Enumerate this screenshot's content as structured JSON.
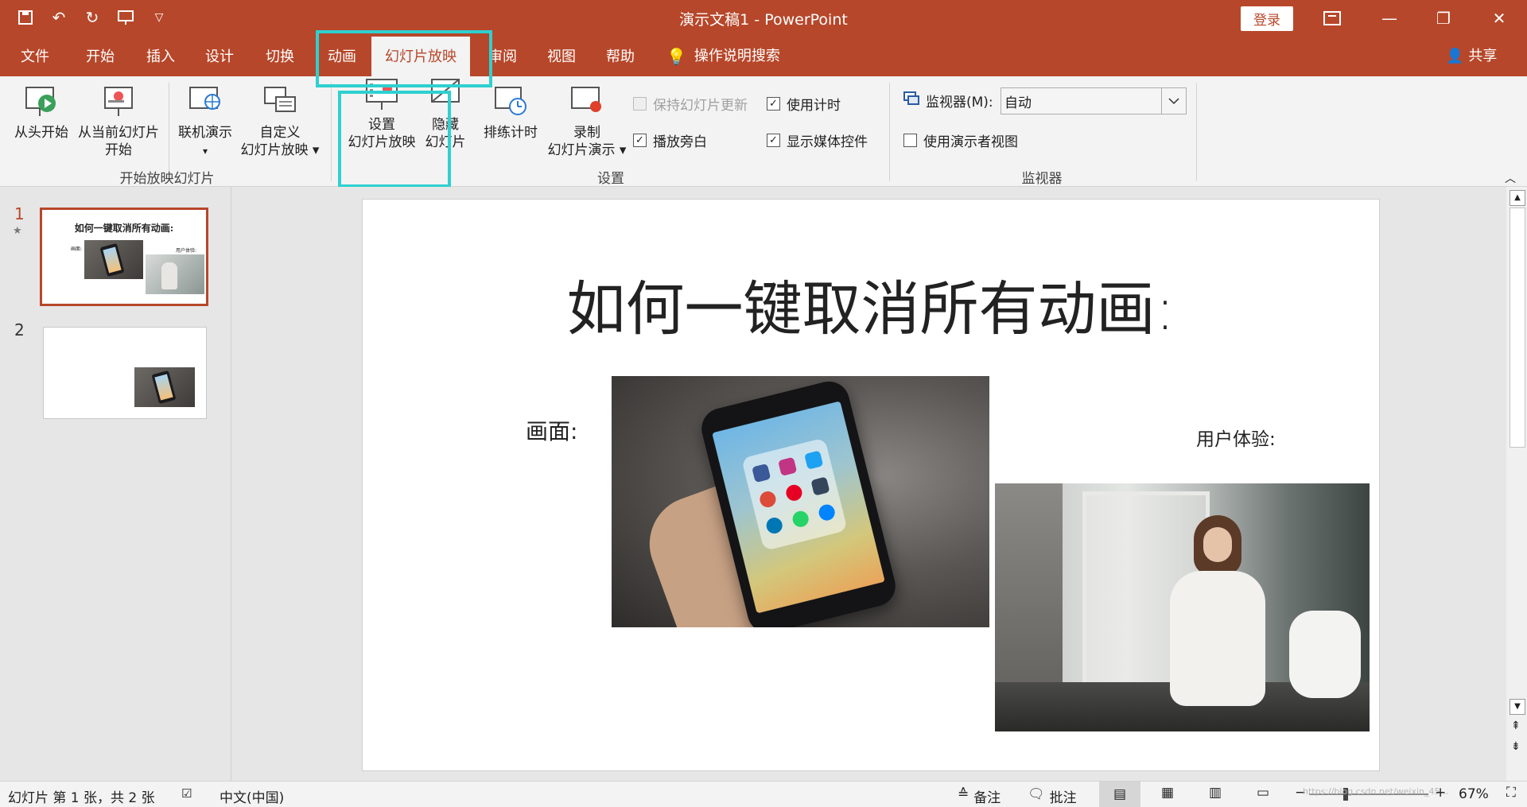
{
  "window": {
    "title": "演示文稿1  -  PowerPoint",
    "login_label": "登录"
  },
  "qat": {
    "icons": [
      "save-icon",
      "undo-icon",
      "redo-icon",
      "present-icon",
      "customize-icon"
    ]
  },
  "tabs": [
    "文件",
    "开始",
    "插入",
    "设计",
    "切换",
    "动画",
    "幻灯片放映",
    "审阅",
    "视图",
    "帮助"
  ],
  "search": {
    "label": "操作说明搜索"
  },
  "share": {
    "label": "共享"
  },
  "ribbon": {
    "btn_from_start": "从头开始",
    "btn_from_current_1": "从当前幻灯片",
    "btn_from_current_2": "开始",
    "btn_online_1": "联机演示",
    "btn_online_2": "▾",
    "btn_custom_1": "自定义",
    "btn_custom_2": "幻灯片放映 ▾",
    "group_start": "开始放映幻灯片",
    "btn_setup_1": "设置",
    "btn_setup_2": "幻灯片放映",
    "btn_hide_1": "隐藏",
    "btn_hide_2": "幻灯片",
    "btn_rehearse": "排练计时",
    "btn_record_1": "录制",
    "btn_record_2": "幻灯片演示 ▾",
    "chk_keep": "保持幻灯片更新",
    "chk_timing": "使用计时",
    "chk_narration": "播放旁白",
    "chk_media": "显示媒体控件",
    "group_setup": "设置",
    "monitor_label": "监视器(M):",
    "monitor_value": "自动",
    "chk_presenter": "使用演示者视图",
    "group_monitor": "监视器"
  },
  "thumbs": [
    {
      "num": "1",
      "title": "如何一键取消所有动画:",
      "label1": "画面:",
      "label2": "用户体验:"
    },
    {
      "num": "2"
    }
  ],
  "slide": {
    "title": "如何一键取消所有动画:",
    "label_picture": "画面:",
    "label_ux": "用户体验:"
  },
  "status": {
    "slide_info": "幻灯片 第 1 张，共 2 张",
    "language": "中文(中国)",
    "notes": "备注",
    "comments": "批注",
    "zoom_minus": "−",
    "zoom_plus": "+",
    "zoom": "67%",
    "watermark": "https://blog.csdn.net/weixin_45..."
  },
  "colors": {
    "accent": "#b7472a",
    "highlight": "#2fd0d0"
  }
}
